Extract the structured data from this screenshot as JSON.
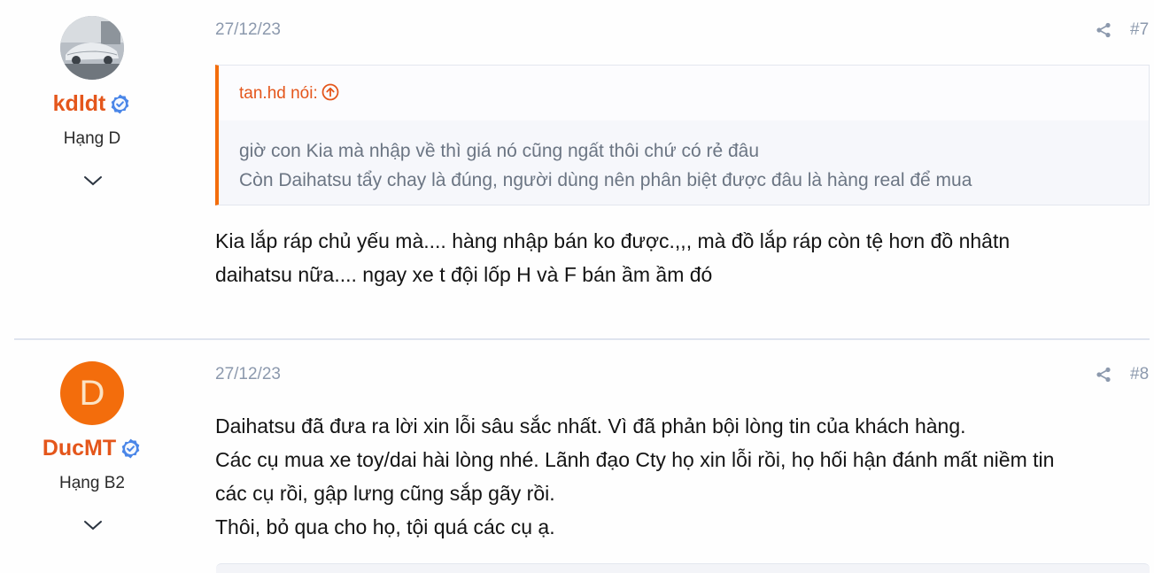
{
  "posts": [
    {
      "username": "kdldt",
      "rank": "Hạng D",
      "date": "27/12/23",
      "post_number": "#7",
      "avatar_icon": "car-photo-avatar",
      "quote": {
        "author": "tan.hd nói:",
        "lines": [
          "giờ con Kia mà nhập về thì giá nó cũng ngất thôi chứ có rẻ đâu",
          "Còn Daihatsu tẩy chay là đúng, người dùng nên phân biệt được đâu là hàng real để mua"
        ]
      },
      "lines": [
        "Kia lắp ráp chủ yếu mà.... hàng nhập bán ko được.,,, mà đồ lắp ráp còn tệ hơn đồ nhâtn",
        "daihatsu nữa.... ngay xe t đội lốp H và F bán ầm ầm đó"
      ]
    },
    {
      "username": "DucMT",
      "rank": "Hạng B2",
      "date": "27/12/23",
      "post_number": "#8",
      "avatar_letter": "D",
      "lines": [
        "Daihatsu đã đưa ra lời xin lỗi sâu sắc nhất. Vì đã phản bội lòng tin của khách hàng.",
        "Các cụ mua xe toy/dai hài lòng nhé. Lãnh đạo Cty họ xin lỗi rồi, họ hối hận đánh mất niềm tin",
        "các cụ rồi, gập lưng cũng sắp gãy rồi.",
        "Thôi, bỏ qua cho họ, tội quá các cụ ạ."
      ]
    }
  ],
  "colors": {
    "username": "#e4561b",
    "accent": "#f36d0c",
    "verified": "#4a86e8",
    "muted": "#8c99ad"
  }
}
